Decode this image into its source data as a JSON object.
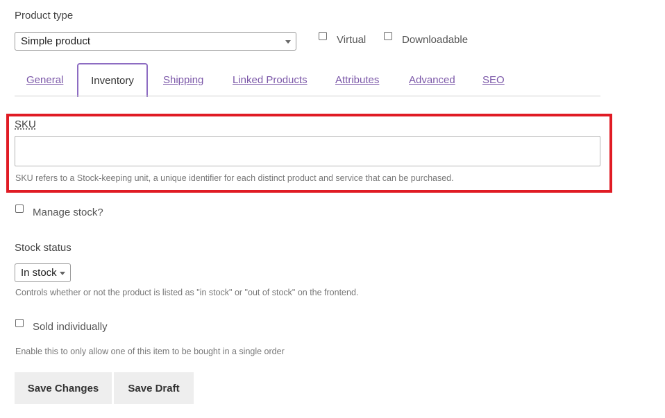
{
  "product_type": {
    "label": "Product type",
    "selected": "Simple product",
    "virtual_label": "Virtual",
    "downloadable_label": "Downloadable",
    "virtual_checked": false,
    "downloadable_checked": false
  },
  "tabs": [
    {
      "label": "General",
      "active": false
    },
    {
      "label": "Inventory",
      "active": true
    },
    {
      "label": "Shipping",
      "active": false
    },
    {
      "label": "Linked Products",
      "active": false
    },
    {
      "label": "Attributes",
      "active": false
    },
    {
      "label": "Advanced",
      "active": false
    },
    {
      "label": "SEO",
      "active": false
    }
  ],
  "sku": {
    "label": "SKU",
    "value": "",
    "help": "SKU refers to a Stock-keeping unit, a unique identifier for each distinct product and service that can be purchased."
  },
  "manage_stock": {
    "label": "Manage stock?",
    "checked": false
  },
  "stock_status": {
    "label": "Stock status",
    "selected": "In stock",
    "help": "Controls whether or not the product is listed as \"in stock\" or \"out of stock\" on the frontend."
  },
  "sold_individually": {
    "label": "Sold individually",
    "checked": false,
    "help": "Enable this to only allow one of this item to be bought in a single order"
  },
  "actions": {
    "save_changes": "Save Changes",
    "save_draft": "Save Draft"
  },
  "colors": {
    "accent": "#7b57a8",
    "highlight": "#e01b24",
    "button_bg": "#eeeeee"
  }
}
